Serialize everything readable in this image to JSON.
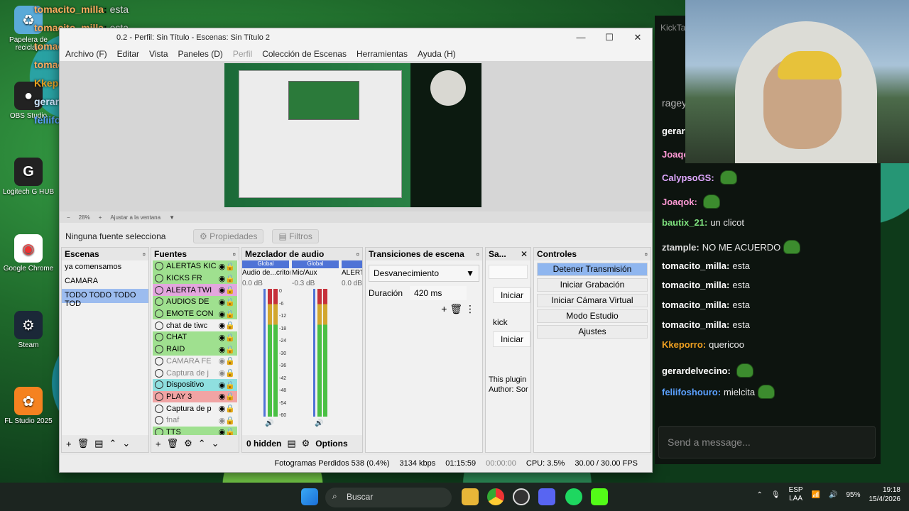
{
  "desktop": {
    "icons": [
      {
        "label": "Papelera de reciclaje",
        "glyph": "♻"
      },
      {
        "label": "OBS Studio",
        "glyph": "●"
      },
      {
        "label": "Logitech G HUB",
        "glyph": "G"
      },
      {
        "label": "Google Chrome",
        "glyph": "◉"
      },
      {
        "label": "Steam",
        "glyph": "⚙"
      },
      {
        "label": "FL Studio 2025",
        "glyph": "✿"
      }
    ],
    "overlay_chat": [
      {
        "user": "tomacito_milla",
        "text": "esta",
        "color": "#ffae60"
      },
      {
        "user": "tomacito_milla",
        "text": "esta",
        "color": "#ffae60"
      },
      {
        "user": "tomacito_milla",
        "text": "esta",
        "color": "#ffae60"
      },
      {
        "user": "tomacito_milla",
        "text": "esta",
        "color": "#ffae60"
      },
      {
        "user": "Kkeporro",
        "text": "quericoo",
        "color": "#e8a020"
      },
      {
        "user": "gerardelvecino",
        "text": "",
        "color": "#cfe8ff"
      },
      {
        "user": "feliifoshouro",
        "text": "mielcita",
        "color": "#5aa0ff"
      }
    ]
  },
  "obs": {
    "title": "0.2 - Perfil: Sin Título - Escenas: Sin Título 2",
    "menu": [
      "Archivo (F)",
      "Editar",
      "Vista",
      "Paneles (D)",
      "Perfil",
      "Colección de Escenas",
      "Herramientas",
      "Ayuda (H)"
    ],
    "zoom": {
      "minus": "−",
      "percent": "28%",
      "plus": "+",
      "fit": "Ajustar a la ventana"
    },
    "no_source": "Ninguna fuente selecciona",
    "properties": "Propiedades",
    "filters": "Filtros",
    "scenes": {
      "title": "Escenas",
      "items": [
        "ya comensamos",
        "CAMARA",
        "TODO TODO TODO TOD"
      ],
      "selected_index": 2
    },
    "sources": {
      "title": "Fuentes",
      "items": [
        {
          "name": "ALERTAS KIC",
          "color": "g"
        },
        {
          "name": "KICKS FR",
          "color": "g"
        },
        {
          "name": "ALERTA TWI",
          "color": "p"
        },
        {
          "name": "AUDIOS DE",
          "color": "g"
        },
        {
          "name": "EMOTE CON",
          "color": "g"
        },
        {
          "name": "chat de tiwc",
          "color": ""
        },
        {
          "name": "CHAT",
          "color": "g"
        },
        {
          "name": "RAID",
          "color": "g"
        },
        {
          "name": "CAMARA FE",
          "color": "gr"
        },
        {
          "name": "Captura de j",
          "color": "gr"
        },
        {
          "name": "Dispositivo",
          "color": "t"
        },
        {
          "name": "PLAY 3",
          "color": "r"
        },
        {
          "name": "Captura de p",
          "color": ""
        },
        {
          "name": "fnaf",
          "color": "gr"
        },
        {
          "name": "TTS",
          "color": "g"
        }
      ]
    },
    "mixer": {
      "title": "Mezclador de audio",
      "channels": [
        {
          "name": "Audio de...critorio",
          "db": "0.0 dB",
          "tag": "Global"
        },
        {
          "name": "Mic/Aux",
          "db": "-0.3 dB",
          "tag": "Global"
        },
        {
          "name": "ALERT",
          "db": "0.0 dB",
          "tag": ""
        }
      ],
      "scale": [
        "0",
        "-6",
        "-12",
        "-18",
        "-24",
        "-30",
        "-36",
        "-42",
        "-48",
        "-54",
        "-60"
      ],
      "hidden": "0 hidden",
      "options": "Options"
    },
    "transitions": {
      "title": "Transiciones de escena",
      "type": "Desvanecimiento",
      "duration_label": "Duración",
      "duration": "420 ms"
    },
    "plugin": {
      "title": "Sa...",
      "btn1": "Iniciar",
      "label": "kick",
      "btn2": "Iniciar",
      "info1": "This plugin",
      "info2": "Author: Sor"
    },
    "controls": {
      "title": "Controles",
      "buttons": [
        "Detener Transmisión",
        "Iniciar Grabación",
        "Iniciar Cámara Virtual",
        "Modo Estudio",
        "Ajustes"
      ]
    },
    "status": {
      "dropped": "Fotogramas Perdidos 538 (0.4%)",
      "kbps": "3134 kbps",
      "live": "01:15:59",
      "rec": "00:00:00",
      "cpu": "CPU: 3.5%",
      "fps": "30.00 / 30.00 FPS"
    }
  },
  "chat": {
    "tab": "KickTa",
    "partial": "ragey",
    "messages": [
      {
        "user": "gerar",
        "text": "",
        "color": "#ffffff",
        "emote": true
      },
      {
        "user": "Joaqok:",
        "text": "",
        "color": "#ff9ad6",
        "emote": true
      },
      {
        "user": "CalypsoGS:",
        "text": "",
        "color": "#e0a8ff",
        "emote": true
      },
      {
        "user": "Joaqok:",
        "text": "",
        "color": "#ff9ad6",
        "emote": true
      },
      {
        "user": "bautix_21:",
        "text": "un clicot",
        "color": "#7ee07e",
        "emote": false
      },
      {
        "user": "ztample:",
        "text": "NO ME ACUERDO",
        "color": "#dddddd",
        "emote": true
      },
      {
        "user": "tomacito_milla:",
        "text": "esta",
        "color": "#ffffff",
        "emote": false
      },
      {
        "user": "tomacito_milla:",
        "text": "esta",
        "color": "#ffffff",
        "emote": false
      },
      {
        "user": "tomacito_milla:",
        "text": "esta",
        "color": "#ffffff",
        "emote": false
      },
      {
        "user": "tomacito_milla:",
        "text": "esta",
        "color": "#ffffff",
        "emote": false
      },
      {
        "user": "Kkeporro:",
        "text": "quericoo",
        "color": "#f0a020",
        "emote": false
      },
      {
        "user": "gerardelvecino:",
        "text": "",
        "color": "#ffffff",
        "emote": true
      },
      {
        "user": "feliifoshouro:",
        "text": "mielcita",
        "color": "#5aa0ff",
        "emote": true
      }
    ],
    "placeholder": "Send a message..."
  },
  "taskbar": {
    "search": "Buscar",
    "lang1": "ESP",
    "lang2": "LAA",
    "battery": "95%",
    "time": "19:18",
    "date": "15/4/2026"
  }
}
